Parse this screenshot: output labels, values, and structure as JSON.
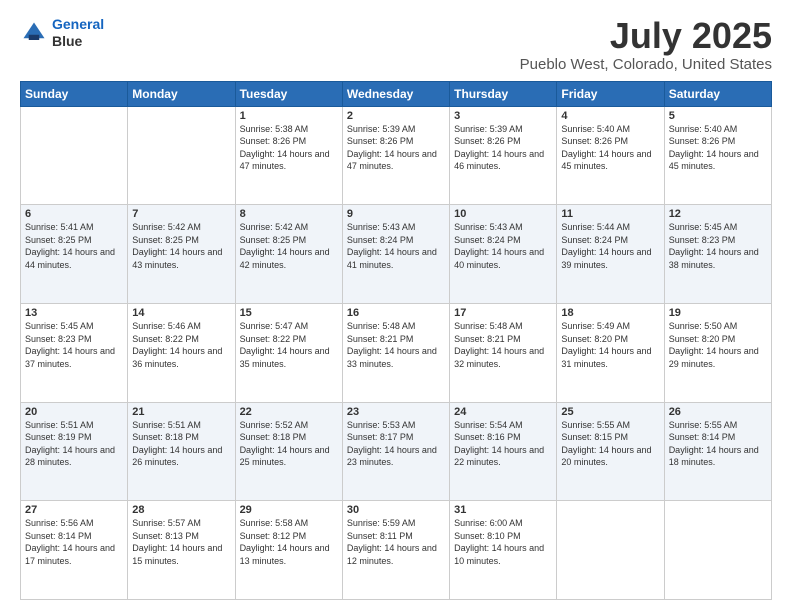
{
  "header": {
    "logo_line1": "General",
    "logo_line2": "Blue",
    "title": "July 2025",
    "subtitle": "Pueblo West, Colorado, United States"
  },
  "days_of_week": [
    "Sunday",
    "Monday",
    "Tuesday",
    "Wednesday",
    "Thursday",
    "Friday",
    "Saturday"
  ],
  "weeks": [
    [
      {
        "day": "",
        "sunrise": "",
        "sunset": "",
        "daylight": ""
      },
      {
        "day": "",
        "sunrise": "",
        "sunset": "",
        "daylight": ""
      },
      {
        "day": "1",
        "sunrise": "Sunrise: 5:38 AM",
        "sunset": "Sunset: 8:26 PM",
        "daylight": "Daylight: 14 hours and 47 minutes."
      },
      {
        "day": "2",
        "sunrise": "Sunrise: 5:39 AM",
        "sunset": "Sunset: 8:26 PM",
        "daylight": "Daylight: 14 hours and 47 minutes."
      },
      {
        "day": "3",
        "sunrise": "Sunrise: 5:39 AM",
        "sunset": "Sunset: 8:26 PM",
        "daylight": "Daylight: 14 hours and 46 minutes."
      },
      {
        "day": "4",
        "sunrise": "Sunrise: 5:40 AM",
        "sunset": "Sunset: 8:26 PM",
        "daylight": "Daylight: 14 hours and 45 minutes."
      },
      {
        "day": "5",
        "sunrise": "Sunrise: 5:40 AM",
        "sunset": "Sunset: 8:26 PM",
        "daylight": "Daylight: 14 hours and 45 minutes."
      }
    ],
    [
      {
        "day": "6",
        "sunrise": "Sunrise: 5:41 AM",
        "sunset": "Sunset: 8:25 PM",
        "daylight": "Daylight: 14 hours and 44 minutes."
      },
      {
        "day": "7",
        "sunrise": "Sunrise: 5:42 AM",
        "sunset": "Sunset: 8:25 PM",
        "daylight": "Daylight: 14 hours and 43 minutes."
      },
      {
        "day": "8",
        "sunrise": "Sunrise: 5:42 AM",
        "sunset": "Sunset: 8:25 PM",
        "daylight": "Daylight: 14 hours and 42 minutes."
      },
      {
        "day": "9",
        "sunrise": "Sunrise: 5:43 AM",
        "sunset": "Sunset: 8:24 PM",
        "daylight": "Daylight: 14 hours and 41 minutes."
      },
      {
        "day": "10",
        "sunrise": "Sunrise: 5:43 AM",
        "sunset": "Sunset: 8:24 PM",
        "daylight": "Daylight: 14 hours and 40 minutes."
      },
      {
        "day": "11",
        "sunrise": "Sunrise: 5:44 AM",
        "sunset": "Sunset: 8:24 PM",
        "daylight": "Daylight: 14 hours and 39 minutes."
      },
      {
        "day": "12",
        "sunrise": "Sunrise: 5:45 AM",
        "sunset": "Sunset: 8:23 PM",
        "daylight": "Daylight: 14 hours and 38 minutes."
      }
    ],
    [
      {
        "day": "13",
        "sunrise": "Sunrise: 5:45 AM",
        "sunset": "Sunset: 8:23 PM",
        "daylight": "Daylight: 14 hours and 37 minutes."
      },
      {
        "day": "14",
        "sunrise": "Sunrise: 5:46 AM",
        "sunset": "Sunset: 8:22 PM",
        "daylight": "Daylight: 14 hours and 36 minutes."
      },
      {
        "day": "15",
        "sunrise": "Sunrise: 5:47 AM",
        "sunset": "Sunset: 8:22 PM",
        "daylight": "Daylight: 14 hours and 35 minutes."
      },
      {
        "day": "16",
        "sunrise": "Sunrise: 5:48 AM",
        "sunset": "Sunset: 8:21 PM",
        "daylight": "Daylight: 14 hours and 33 minutes."
      },
      {
        "day": "17",
        "sunrise": "Sunrise: 5:48 AM",
        "sunset": "Sunset: 8:21 PM",
        "daylight": "Daylight: 14 hours and 32 minutes."
      },
      {
        "day": "18",
        "sunrise": "Sunrise: 5:49 AM",
        "sunset": "Sunset: 8:20 PM",
        "daylight": "Daylight: 14 hours and 31 minutes."
      },
      {
        "day": "19",
        "sunrise": "Sunrise: 5:50 AM",
        "sunset": "Sunset: 8:20 PM",
        "daylight": "Daylight: 14 hours and 29 minutes."
      }
    ],
    [
      {
        "day": "20",
        "sunrise": "Sunrise: 5:51 AM",
        "sunset": "Sunset: 8:19 PM",
        "daylight": "Daylight: 14 hours and 28 minutes."
      },
      {
        "day": "21",
        "sunrise": "Sunrise: 5:51 AM",
        "sunset": "Sunset: 8:18 PM",
        "daylight": "Daylight: 14 hours and 26 minutes."
      },
      {
        "day": "22",
        "sunrise": "Sunrise: 5:52 AM",
        "sunset": "Sunset: 8:18 PM",
        "daylight": "Daylight: 14 hours and 25 minutes."
      },
      {
        "day": "23",
        "sunrise": "Sunrise: 5:53 AM",
        "sunset": "Sunset: 8:17 PM",
        "daylight": "Daylight: 14 hours and 23 minutes."
      },
      {
        "day": "24",
        "sunrise": "Sunrise: 5:54 AM",
        "sunset": "Sunset: 8:16 PM",
        "daylight": "Daylight: 14 hours and 22 minutes."
      },
      {
        "day": "25",
        "sunrise": "Sunrise: 5:55 AM",
        "sunset": "Sunset: 8:15 PM",
        "daylight": "Daylight: 14 hours and 20 minutes."
      },
      {
        "day": "26",
        "sunrise": "Sunrise: 5:55 AM",
        "sunset": "Sunset: 8:14 PM",
        "daylight": "Daylight: 14 hours and 18 minutes."
      }
    ],
    [
      {
        "day": "27",
        "sunrise": "Sunrise: 5:56 AM",
        "sunset": "Sunset: 8:14 PM",
        "daylight": "Daylight: 14 hours and 17 minutes."
      },
      {
        "day": "28",
        "sunrise": "Sunrise: 5:57 AM",
        "sunset": "Sunset: 8:13 PM",
        "daylight": "Daylight: 14 hours and 15 minutes."
      },
      {
        "day": "29",
        "sunrise": "Sunrise: 5:58 AM",
        "sunset": "Sunset: 8:12 PM",
        "daylight": "Daylight: 14 hours and 13 minutes."
      },
      {
        "day": "30",
        "sunrise": "Sunrise: 5:59 AM",
        "sunset": "Sunset: 8:11 PM",
        "daylight": "Daylight: 14 hours and 12 minutes."
      },
      {
        "day": "31",
        "sunrise": "Sunrise: 6:00 AM",
        "sunset": "Sunset: 8:10 PM",
        "daylight": "Daylight: 14 hours and 10 minutes."
      },
      {
        "day": "",
        "sunrise": "",
        "sunset": "",
        "daylight": ""
      },
      {
        "day": "",
        "sunrise": "",
        "sunset": "",
        "daylight": ""
      }
    ]
  ]
}
